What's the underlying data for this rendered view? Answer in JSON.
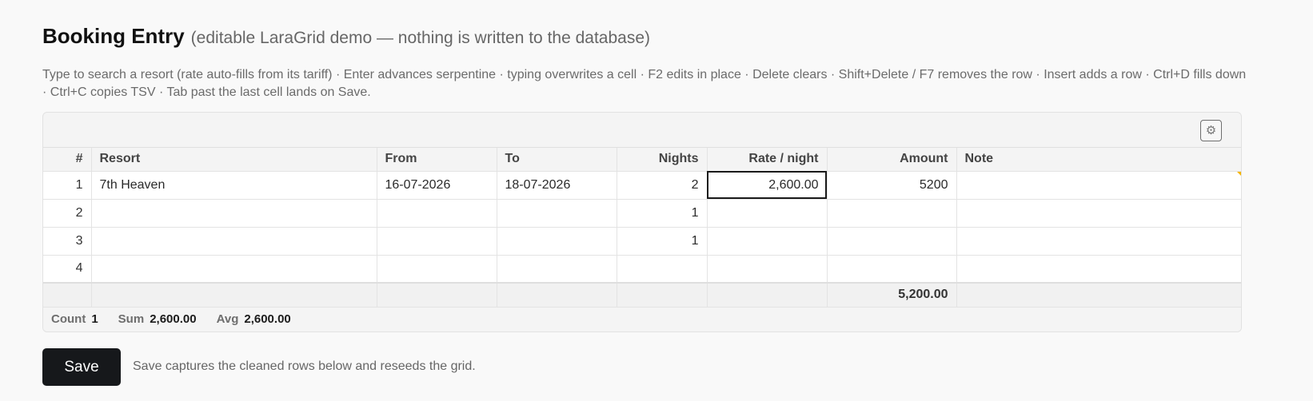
{
  "header": {
    "title": "Booking Entry",
    "subtitle": "(editable LaraGrid demo — nothing is written to the database)"
  },
  "help_text": "Type to search a resort (rate auto-fills from its tariff) · Enter advances serpentine · typing overwrites a cell · F2 edits in place · Delete clears · Shift+Delete / F7 removes the row · Insert adds a row · Ctrl+D fills down · Ctrl+C copies TSV · Tab past the last cell lands on Save.",
  "toolbar": {
    "settings_icon": "gear-icon"
  },
  "grid": {
    "columns": [
      "#",
      "Resort",
      "From",
      "To",
      "Nights",
      "Rate / night",
      "Amount",
      "Note"
    ],
    "rows": [
      {
        "num": "1",
        "resort": "7th Heaven",
        "from": "16-07-2026",
        "to": "18-07-2026",
        "nights": "2",
        "rate": "2,600.00",
        "amount": "5200",
        "note": ""
      },
      {
        "num": "2",
        "resort": "",
        "from": "",
        "to": "",
        "nights": "1",
        "rate": "",
        "amount": "",
        "note": ""
      },
      {
        "num": "3",
        "resort": "",
        "from": "",
        "to": "",
        "nights": "1",
        "rate": "",
        "amount": "",
        "note": ""
      },
      {
        "num": "4",
        "resort": "",
        "from": "",
        "to": "",
        "nights": "",
        "rate": "",
        "amount": "",
        "note": ""
      }
    ],
    "footer": {
      "amount_total": "5,200.00"
    },
    "active_cell": {
      "row": 1,
      "column": "Rate / night"
    }
  },
  "status": {
    "count_label": "Count",
    "count_value": "1",
    "sum_label": "Sum",
    "sum_value": "2,600.00",
    "avg_label": "Avg",
    "avg_value": "2,600.00"
  },
  "actions": {
    "save_label": "Save",
    "save_note": "Save captures the cleaned rows below and reseeds the grid."
  },
  "colors": {
    "save_button": "#16181b",
    "dirty_marker": "#f5b400",
    "active_border": "#1a1a1a"
  }
}
